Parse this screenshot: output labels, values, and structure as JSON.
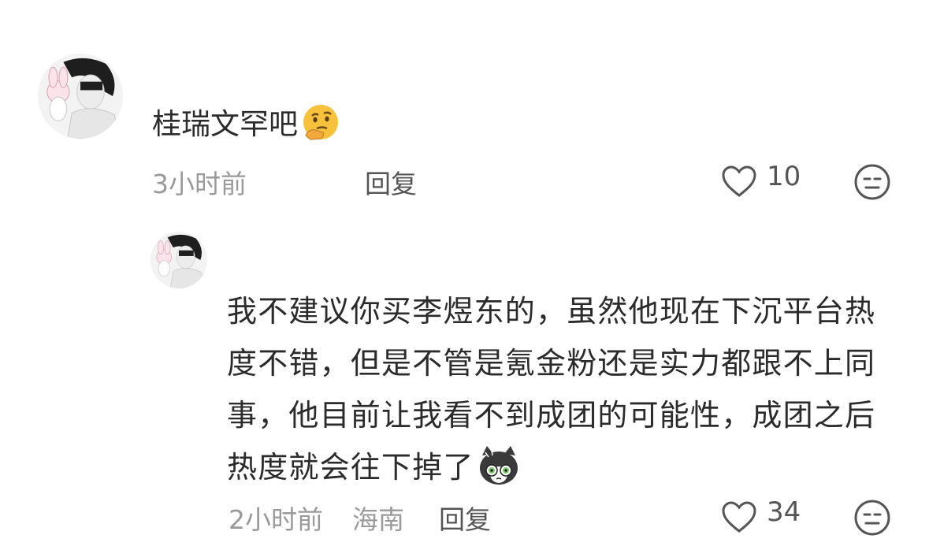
{
  "comments": [
    {
      "text": "桂瑞文罕吧",
      "emoji": "thinking-face",
      "time": "3小时前",
      "location": "",
      "reply_label": "回复",
      "likes": "10"
    },
    {
      "text": "我不建议你买李煜东的，虽然他现在下沉平台热度不错，但是不管是氪金粉还是实力都跟不上同事，他目前让我看不到成团的可能性，成团之后热度就会往下掉了",
      "emoji": "shocked-cat-sticker",
      "time": "2小时前",
      "location": "海南",
      "reply_label": "回复",
      "likes": "34"
    }
  ],
  "colors": {
    "text": "#2b2b2b",
    "meta": "#9a9a9a",
    "icon": "#555555"
  }
}
